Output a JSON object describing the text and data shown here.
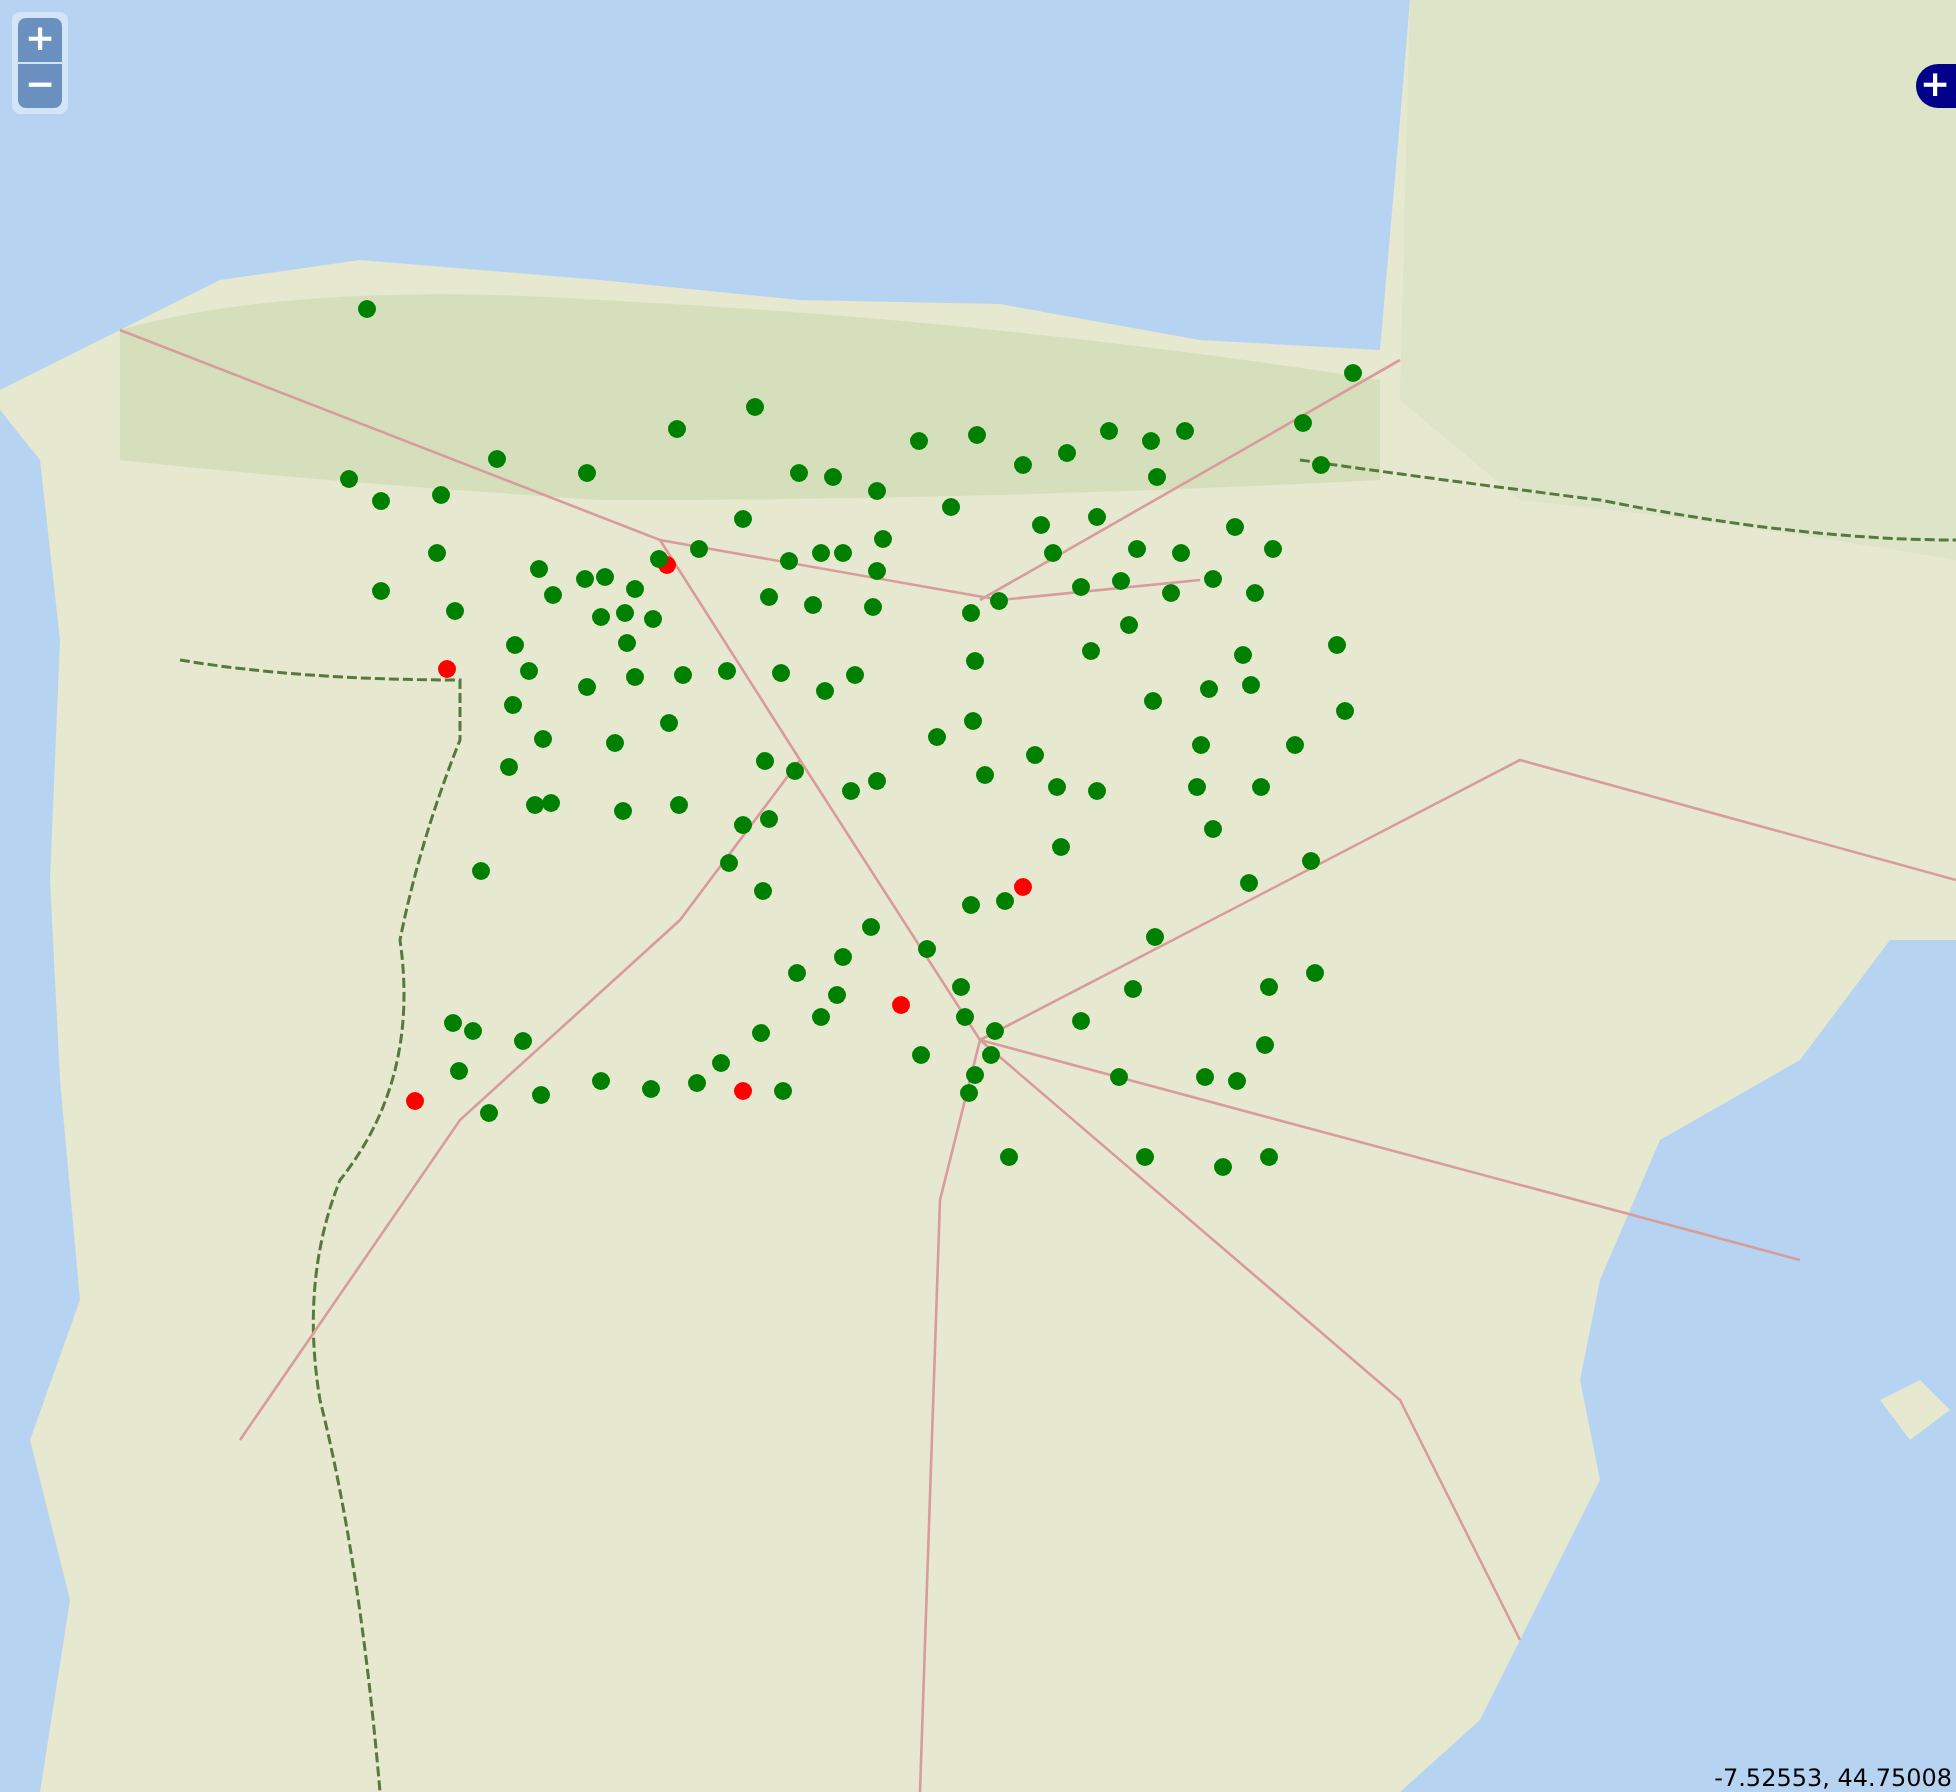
{
  "zoom_controls": [
    {
      "kind": "in",
      "label": "+"
    },
    {
      "kind": "out",
      "label": "−"
    }
  ],
  "layer_switcher": {
    "label": "+"
  },
  "mouse_position": "-7.52553, 44.75008",
  "markers": [
    {
      "color": "#ff0000"
    },
    {
      "color": "#ff0000"
    },
    {
      "color": "#ff0000"
    },
    {
      "color": "#ff0000"
    },
    {
      "color": "#ff0000"
    },
    {
      "color": "#ff0000"
    },
    {
      "color": "#008000"
    },
    {
      "color": "#008000"
    },
    {
      "color": "#008000"
    },
    {
      "color": "#008000"
    },
    {
      "color": "#008000"
    },
    {
      "color": "#008000"
    },
    {
      "color": "#008000"
    },
    {
      "color": "#008000"
    },
    {
      "color": "#008000"
    },
    {
      "color": "#008000"
    },
    {
      "color": "#008000"
    },
    {
      "color": "#008000"
    },
    {
      "color": "#008000"
    },
    {
      "color": "#008000"
    },
    {
      "color": "#008000"
    },
    {
      "color": "#008000"
    },
    {
      "color": "#008000"
    },
    {
      "color": "#008000"
    },
    {
      "color": "#008000"
    },
    {
      "color": "#008000"
    },
    {
      "color": "#008000"
    },
    {
      "color": "#008000"
    },
    {
      "color": "#008000"
    },
    {
      "color": "#008000"
    },
    {
      "color": "#008000"
    },
    {
      "color": "#008000"
    },
    {
      "color": "#008000"
    },
    {
      "color": "#008000"
    },
    {
      "color": "#008000"
    },
    {
      "color": "#008000"
    },
    {
      "color": "#008000"
    },
    {
      "color": "#008000"
    },
    {
      "color": "#008000"
    },
    {
      "color": "#008000"
    },
    {
      "color": "#008000"
    },
    {
      "color": "#008000"
    },
    {
      "color": "#008000"
    },
    {
      "color": "#008000"
    },
    {
      "color": "#008000"
    },
    {
      "color": "#008000"
    },
    {
      "color": "#008000"
    },
    {
      "color": "#008000"
    },
    {
      "color": "#008000"
    },
    {
      "color": "#008000"
    },
    {
      "color": "#008000"
    },
    {
      "color": "#008000"
    },
    {
      "color": "#008000"
    },
    {
      "color": "#008000"
    },
    {
      "color": "#008000"
    },
    {
      "color": "#008000"
    },
    {
      "color": "#008000"
    },
    {
      "color": "#008000"
    },
    {
      "color": "#008000"
    },
    {
      "color": "#008000"
    },
    {
      "color": "#008000"
    },
    {
      "color": "#008000"
    },
    {
      "color": "#008000"
    },
    {
      "color": "#008000"
    },
    {
      "color": "#008000"
    },
    {
      "color": "#008000"
    },
    {
      "color": "#008000"
    },
    {
      "color": "#008000"
    },
    {
      "color": "#008000"
    },
    {
      "color": "#008000"
    },
    {
      "color": "#008000"
    },
    {
      "color": "#008000"
    },
    {
      "color": "#008000"
    },
    {
      "color": "#008000"
    },
    {
      "color": "#008000"
    },
    {
      "color": "#008000"
    },
    {
      "color": "#008000"
    },
    {
      "color": "#008000"
    },
    {
      "color": "#008000"
    },
    {
      "color": "#008000"
    },
    {
      "color": "#008000"
    },
    {
      "color": "#008000"
    },
    {
      "color": "#008000"
    },
    {
      "color": "#008000"
    },
    {
      "color": "#008000"
    },
    {
      "color": "#008000"
    },
    {
      "color": "#008000"
    },
    {
      "color": "#008000"
    },
    {
      "color": "#008000"
    },
    {
      "color": "#008000"
    },
    {
      "color": "#008000"
    },
    {
      "color": "#008000"
    },
    {
      "color": "#008000"
    },
    {
      "color": "#008000"
    },
    {
      "color": "#008000"
    },
    {
      "color": "#008000"
    },
    {
      "color": "#008000"
    },
    {
      "color": "#008000"
    },
    {
      "color": "#008000"
    },
    {
      "color": "#008000"
    },
    {
      "color": "#008000"
    },
    {
      "color": "#008000"
    },
    {
      "color": "#008000"
    },
    {
      "color": "#008000"
    },
    {
      "color": "#008000"
    },
    {
      "color": "#008000"
    },
    {
      "color": "#008000"
    },
    {
      "color": "#008000"
    },
    {
      "color": "#008000"
    },
    {
      "color": "#008000"
    },
    {
      "color": "#008000"
    },
    {
      "color": "#008000"
    },
    {
      "color": "#008000"
    },
    {
      "color": "#008000"
    },
    {
      "color": "#008000"
    },
    {
      "color": "#008000"
    },
    {
      "color": "#008000"
    },
    {
      "color": "#008000"
    },
    {
      "color": "#008000"
    },
    {
      "color": "#008000"
    },
    {
      "color": "#008000"
    },
    {
      "color": "#008000"
    },
    {
      "color": "#008000"
    },
    {
      "color": "#008000"
    },
    {
      "color": "#008000"
    },
    {
      "color": "#008000"
    },
    {
      "color": "#008000"
    },
    {
      "color": "#008000"
    },
    {
      "color": "#008000"
    },
    {
      "color": "#008000"
    },
    {
      "color": "#008000"
    },
    {
      "color": "#008000"
    },
    {
      "color": "#008000"
    },
    {
      "color": "#008000"
    },
    {
      "color": "#008000"
    },
    {
      "color": "#008000"
    },
    {
      "color": "#008000"
    },
    {
      "color": "#008000"
    },
    {
      "color": "#008000"
    },
    {
      "color": "#008000"
    },
    {
      "color": "#008000"
    },
    {
      "color": "#008000"
    },
    {
      "color": "#008000"
    },
    {
      "color": "#008000"
    },
    {
      "color": "#008000"
    },
    {
      "color": "#008000"
    },
    {
      "color": "#008000"
    },
    {
      "color": "#008000"
    },
    {
      "color": "#008000"
    },
    {
      "color": "#008000"
    },
    {
      "color": "#008000"
    },
    {
      "color": "#008000"
    },
    {
      "color": "#008000"
    },
    {
      "color": "#008000"
    },
    {
      "color": "#008000"
    },
    {
      "color": "#008000"
    }
  ]
}
